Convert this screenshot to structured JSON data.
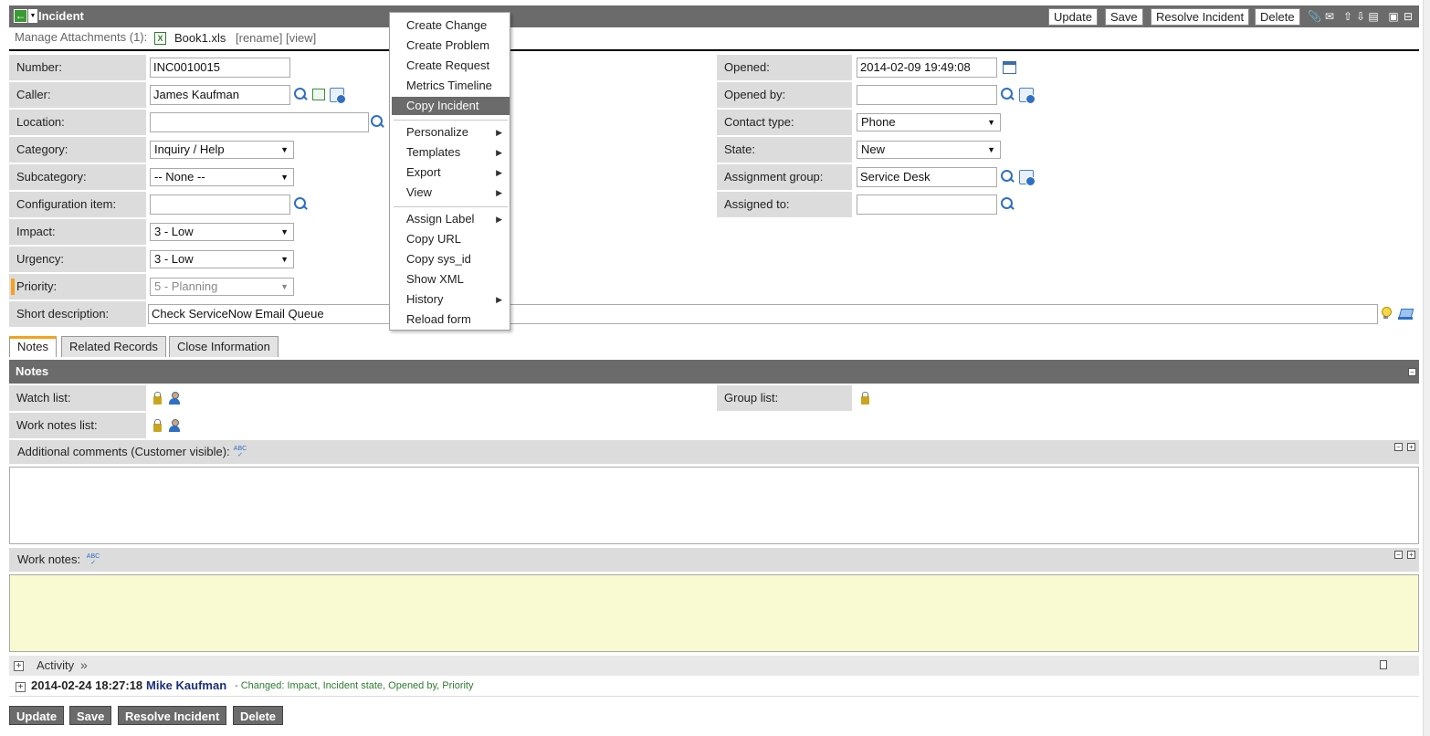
{
  "header": {
    "title": "Incident",
    "buttons": {
      "update": "Update",
      "save": "Save",
      "resolve": "Resolve Incident",
      "delete": "Delete"
    }
  },
  "attachments": {
    "label": "Manage Attachments (1):",
    "file": "Book1.xls",
    "rename": "[rename]",
    "view": "[view]"
  },
  "form": {
    "number": {
      "label": "Number:",
      "value": "INC0010015"
    },
    "caller": {
      "label": "Caller:",
      "value": "James Kaufman"
    },
    "location": {
      "label": "Location:",
      "value": ""
    },
    "category": {
      "label": "Category:",
      "value": "Inquiry / Help"
    },
    "subcategory": {
      "label": "Subcategory:",
      "value": "-- None --"
    },
    "ci": {
      "label": "Configuration item:",
      "value": ""
    },
    "impact": {
      "label": "Impact:",
      "value": "3 - Low"
    },
    "urgency": {
      "label": "Urgency:",
      "value": "3 - Low"
    },
    "priority": {
      "label": "Priority:",
      "value": "5 - Planning"
    },
    "short_description": {
      "label": "Short description:",
      "value": "Check ServiceNow Email Queue"
    },
    "opened": {
      "label": "Opened:",
      "value": "2014-02-09 19:49:08"
    },
    "opened_by": {
      "label": "Opened by:",
      "value": ""
    },
    "contact_type": {
      "label": "Contact type:",
      "value": "Phone"
    },
    "state": {
      "label": "State:",
      "value": "New"
    },
    "assignment_group": {
      "label": "Assignment group:",
      "value": "Service Desk"
    },
    "assigned_to": {
      "label": "Assigned to:",
      "value": ""
    }
  },
  "tabs": [
    {
      "label": "Notes",
      "active": true
    },
    {
      "label": "Related Records",
      "active": false
    },
    {
      "label": "Close Information",
      "active": false
    }
  ],
  "notes": {
    "title": "Notes",
    "watch_list": "Watch list:",
    "work_notes_list": "Work notes list:",
    "group_list": "Group list:",
    "additional_comments": "Additional comments (Customer visible):",
    "work_notes": "Work notes:",
    "spell_glyph": "ABC"
  },
  "activity": {
    "title": "Activity",
    "chevron": "»",
    "entry": {
      "timestamp": "2014-02-24 18:27:18",
      "user": "Mike Kaufman",
      "change": "- Changed:  Impact, Incident state, Opened by, Priority"
    }
  },
  "footer_buttons": {
    "update": "Update",
    "save": "Save",
    "resolve": "Resolve Incident",
    "delete": "Delete"
  },
  "context_menu": {
    "items": [
      {
        "label": "Create Change"
      },
      {
        "label": "Create Problem"
      },
      {
        "label": "Create Request"
      },
      {
        "label": "Metrics Timeline"
      },
      {
        "label": "Copy Incident",
        "highlighted": true
      },
      {
        "label": "Personalize",
        "submenu": true
      },
      {
        "label": "Templates",
        "submenu": true
      },
      {
        "label": "Export",
        "submenu": true
      },
      {
        "label": "View",
        "submenu": true
      },
      {
        "label": "Assign Label",
        "submenu": true
      },
      {
        "label": "Copy URL"
      },
      {
        "label": "Copy sys_id"
      },
      {
        "label": "Show XML"
      },
      {
        "label": "History",
        "submenu": true
      },
      {
        "label": "Reload form"
      }
    ]
  },
  "colors": {
    "header_bg": "#6b6b6b",
    "label_bg": "#dcdcdc",
    "accent_orange": "#f5a21b",
    "work_notes_bg": "#fafad2",
    "user_link": "#1a2f7a",
    "change_text": "#2e7d2e"
  },
  "icons": [
    "back-arrow-icon",
    "search-icon",
    "reference-icon",
    "calendar-icon",
    "lock-icon",
    "user-add-icon",
    "bulb-icon",
    "spell-check-icon",
    "excel-icon",
    "paperclip-icon",
    "email-icon",
    "up-arrow-icon",
    "down-arrow-icon"
  ]
}
